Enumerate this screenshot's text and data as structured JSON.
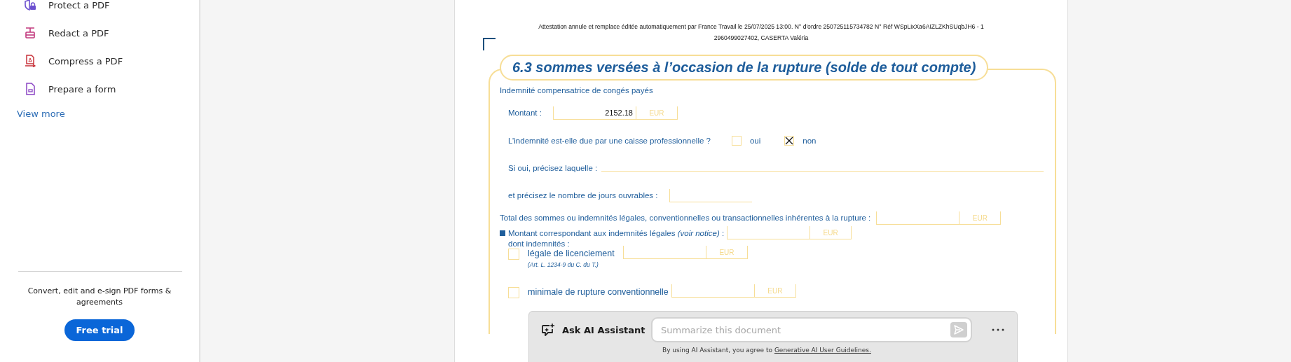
{
  "sidebar": {
    "tools": [
      {
        "label": "Protect a PDF",
        "kind": "protect"
      },
      {
        "label": "Redact a PDF",
        "kind": "redact"
      },
      {
        "label": "Compress a PDF",
        "kind": "compress"
      },
      {
        "label": "Prepare a form",
        "kind": "form"
      }
    ],
    "view_more": "View more",
    "promo": {
      "text": "Convert, edit and e-sign PDF forms & agreements",
      "button": "Free trial"
    }
  },
  "document": {
    "header_lines": [
      "Attestation annule et remplace éditée automatiquement par France Travail le 25/07/2025 13:00. N° d'ordre 250725115734782 N° Réf WSpLixXa6AIZLZKhSUqbJH6 - 1",
      "2960499027402, CASERTA Valéria"
    ],
    "section_title": "6.3 sommes versées à l’occasion de la rupture (solde de tout compte)",
    "subtitle": "Indemnité compensatrice de congés payés",
    "rows": [
      {
        "kind": "amount",
        "label": "Montant :",
        "value": "2152.18",
        "unit": "EUR"
      },
      {
        "kind": "choice",
        "label": "L’indemnité est-elle due par une caisse professionnelle ?",
        "options": [
          {
            "label": "oui",
            "checked": false
          },
          {
            "label": "non",
            "checked": true
          }
        ]
      },
      {
        "kind": "line",
        "label": "Si oui, précisez laquelle :"
      },
      {
        "kind": "amount",
        "label": "et précisez le nombre de jours ouvrables :"
      },
      {
        "kind": "total",
        "label": "Total des sommes ou indemnités légales, conventionnelles ou transactionnelles inhérentes à la rupture :",
        "unit": "EUR"
      },
      {
        "kind": "bullet",
        "label": "Montant correspondant aux indemnités légales *(voir notice)* :",
        "unit": "EUR",
        "sub": "dont indemnités :"
      },
      {
        "kind": "check",
        "label": "légale de licenciement",
        "ref": "(Art. L. 1234-9 du C. du T.)",
        "checked": false,
        "unit": "EUR"
      },
      {
        "kind": "check",
        "label": "minimale de rupture conventionnelle",
        "checked": false,
        "unit": "EUR"
      }
    ]
  },
  "ai_bar": {
    "title": "Ask AI Assistant",
    "placeholder": "Summarize this document",
    "disclaimer": "By using AI Assistant, you agree to",
    "link": "Generative AI User Guidelines."
  }
}
